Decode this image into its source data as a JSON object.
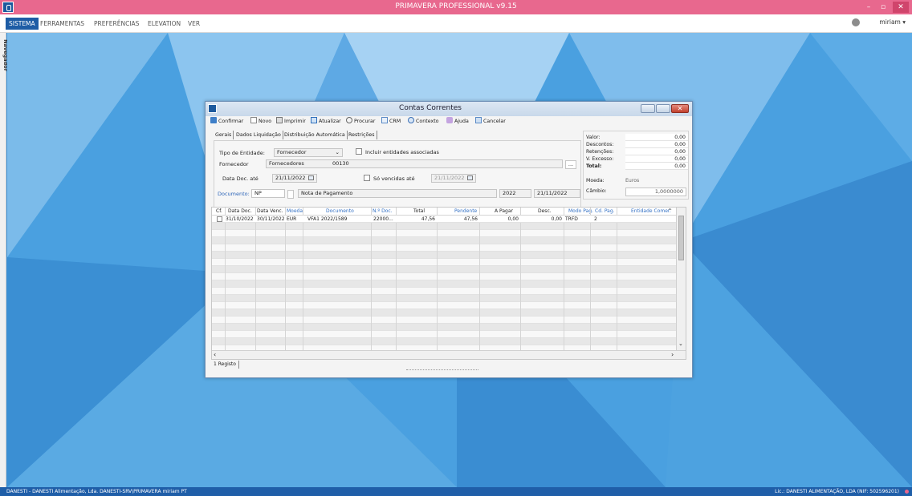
{
  "app": {
    "title": "PRIMAVERA PROFESSIONAL v9.15",
    "accent_color": "#e8688e",
    "minimize_glyph": "–",
    "restore_glyph": "▫",
    "close_glyph": "✕"
  },
  "menu": {
    "items": [
      "SISTEMA",
      "FERRAMENTAS",
      "PREFERÊNCIAS",
      "ELEVATION",
      "VER"
    ],
    "user": "miriam ▾"
  },
  "navigator": {
    "label": "Navegador"
  },
  "dialog": {
    "title": "Contas Correntes",
    "close_glyph": "✕",
    "toolbar": {
      "confirmar": "Confirmar",
      "novo": "Novo",
      "imprimir": "Imprimir",
      "atualizar": "Atualizar",
      "procurar": "Procurar",
      "crm": "CRM",
      "contexto": "Contexto",
      "ajuda": "Ajuda",
      "cancelar": "Cancelar"
    },
    "tabs": [
      "Gerais",
      "Dados Liquidação",
      "Distribuição Automática",
      "Restrições"
    ],
    "form": {
      "tipo_entidade_label": "Tipo de Entidade:",
      "tipo_entidade_value": "Fornecedor",
      "incluir_label": "Incluir entidades associadas",
      "fornecedor_label": "Fornecedor",
      "fornecedor_nome": "Fornecedores",
      "fornecedor_codigo": "00130",
      "browse": "...",
      "data_doc_label": "Data Doc. até",
      "data_doc_value": "21/11/2022",
      "so_vencidas_label": "Só vencidas até",
      "so_vencidas_value": "21/11/2022",
      "documento_label": "Documento:",
      "documento_code": "NP",
      "documento_desc": "Nota de Pagamento",
      "ano": "2022",
      "data_fim": "21/11/2022"
    },
    "totals": {
      "valor_label": "Valor:",
      "valor": "0,00",
      "descontos_label": "Descontos:",
      "descontos": "0,00",
      "retencoes_label": "Retenções:",
      "retencoes": "0,00",
      "excesso_label": "V. Excesso:",
      "excesso": "0,00",
      "total_label": "Total:",
      "total": "0,00",
      "moeda_label": "Moeda:",
      "moeda": "Euros",
      "cambio_label": "Câmbio:",
      "cambio": "1,0000000"
    },
    "grid": {
      "columns": [
        "Cf.",
        "Data Doc.",
        "Data Venc.",
        "Moeda",
        "Documento",
        "N.º Doc.",
        "Total",
        "Pendente",
        "A Pagar",
        "Desc.",
        "Modo Pag.",
        "Cd. Pag.",
        "Entidade Comer."
      ],
      "rows": [
        {
          "data_doc": "31/10/2022",
          "data_venc": "30/11/2022",
          "moeda": "EUR",
          "documento": "VFA1 2022/1589",
          "num_doc": "22000...",
          "total": "47,56",
          "pendente": "47,56",
          "a_pagar": "0,00",
          "desc": "0,00",
          "modo_pag": "TRFD",
          "cd_pag": "2"
        }
      ]
    },
    "footer_tab": "1 Registo"
  },
  "statusbar": {
    "left": "DANESTI - DANESTI Alimentação, Lda.   DANESTI-SRV\\PRIMAVERA   miriam  PT",
    "right": "Lic.: DANESTI ALIMENTAÇÃO, LDA (NIF: 502596201)"
  }
}
